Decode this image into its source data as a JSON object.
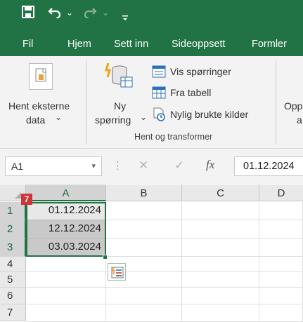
{
  "quick_access": {
    "icons": [
      "save-icon",
      "undo-icon",
      "redo-icon",
      "customize-icon"
    ],
    "undo_caret": "⌄",
    "redo_caret": "⌄"
  },
  "ribbon_tabs": [
    "Fil",
    "Hjem",
    "Sett inn",
    "Sideoppsett",
    "Formler"
  ],
  "ribbon": {
    "hent_eksterne": {
      "line1": "Hent eksterne",
      "line2": "data",
      "caret": "⌄"
    },
    "ny_sporring": {
      "line1": "Ny",
      "line2": "spørring",
      "caret": "⌄"
    },
    "vis_sporringer": "Vis spørringer",
    "fra_tabell": "Fra tabell",
    "nylig_brukte": "Nylig brukte kilder",
    "group_label": "Hent og transformer",
    "partial_line1": "Opp",
    "partial_line2": "a"
  },
  "formula_bar": {
    "name_box": "A1",
    "name_caret": "▾",
    "dots": "⋮",
    "cancel": "✕",
    "enter": "✓",
    "fx": "fx",
    "content": "01.12.2024"
  },
  "grid": {
    "columns": [
      "A",
      "B",
      "C",
      "D"
    ],
    "rows": [
      "1",
      "2",
      "3",
      "4",
      "5",
      "6",
      "7"
    ],
    "cells": {
      "A1": "01.12.2024",
      "A2": "12.12.2024",
      "A3": "03.03.2024"
    },
    "badge": "7"
  },
  "colors": {
    "excel_green": "#217346",
    "selection_fill": "#c9c9c9",
    "badge_red": "#d13438"
  }
}
